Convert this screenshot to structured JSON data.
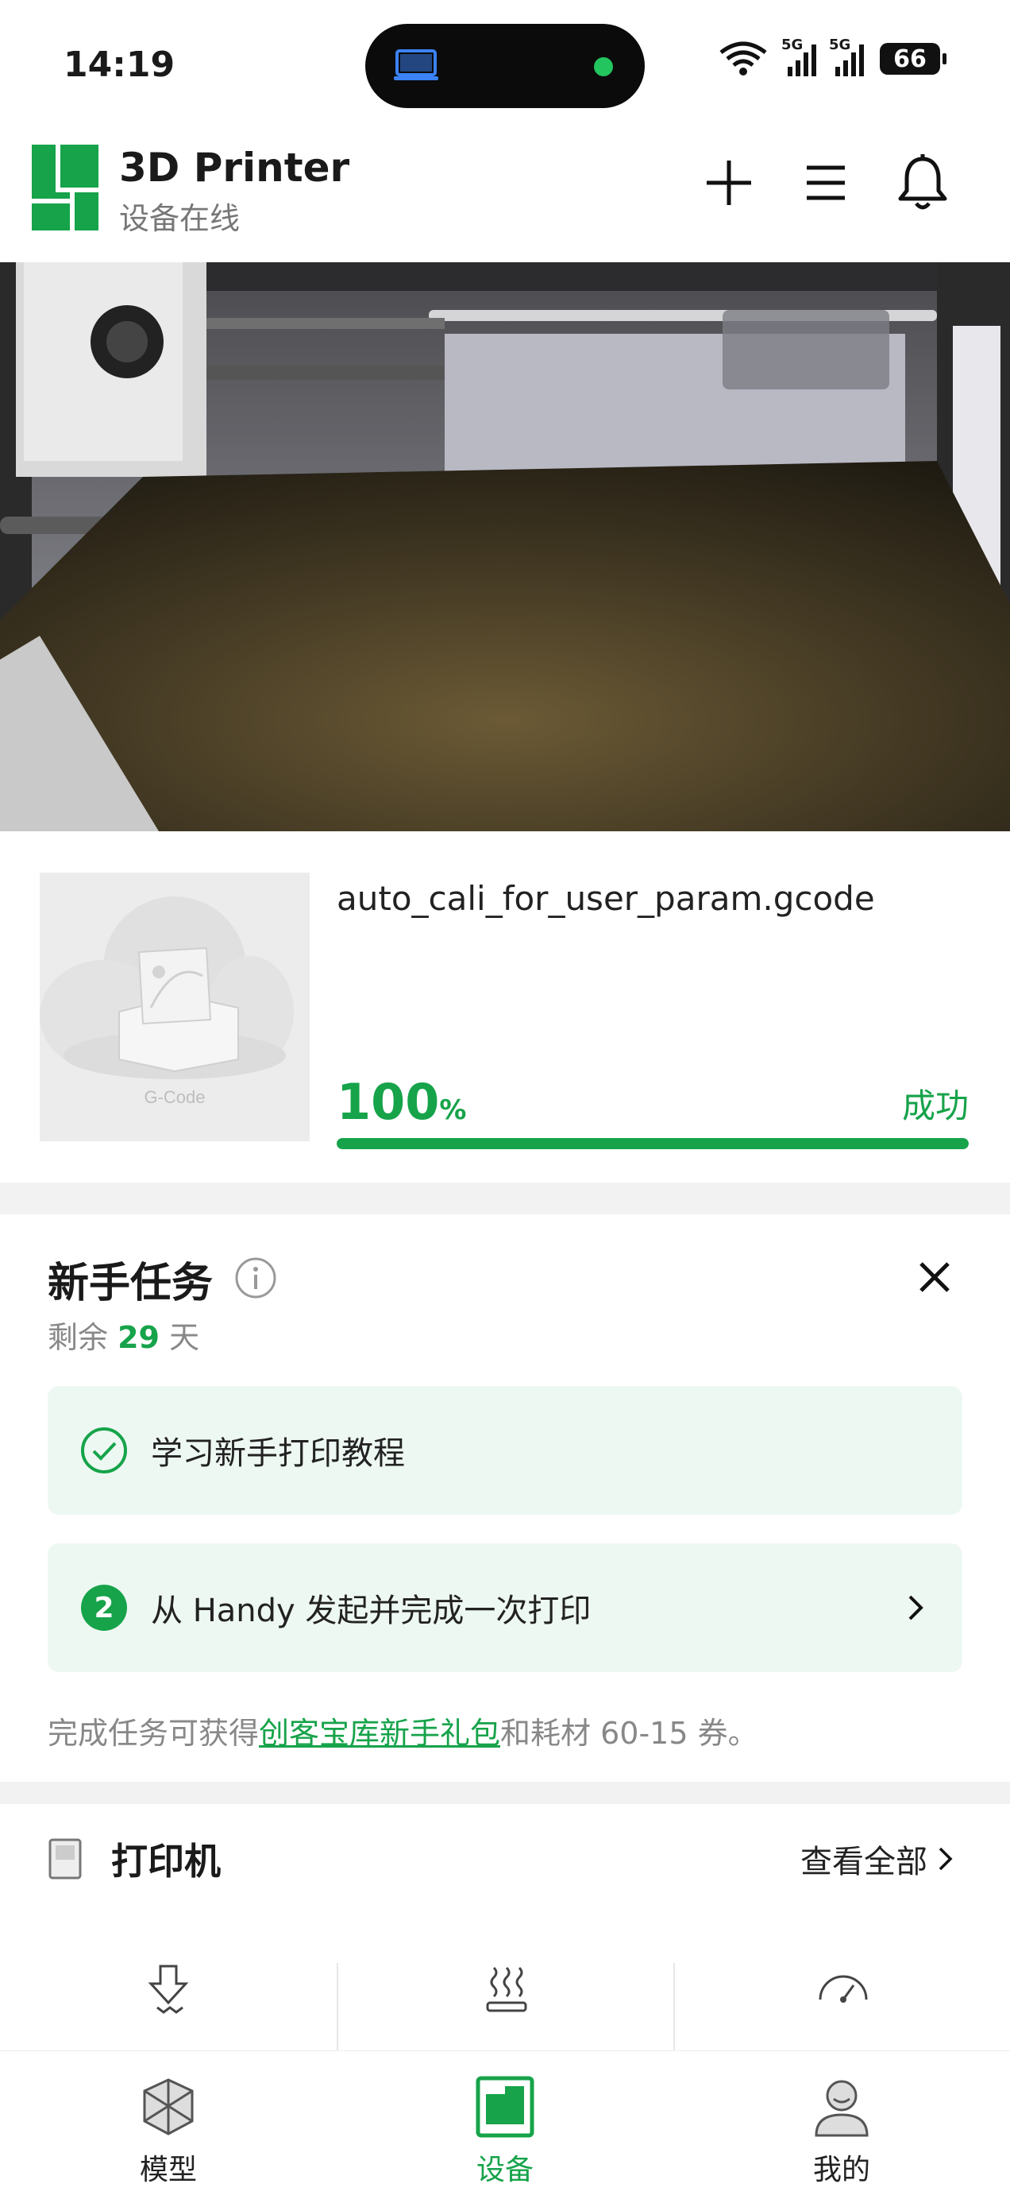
{
  "status_bar": {
    "time": "14:19",
    "signal_1": "5G",
    "signal_2": "5G",
    "battery": "66"
  },
  "header": {
    "title": "3D Printer",
    "subtitle": "设备在线"
  },
  "job": {
    "file_name": "auto_cali_for_user_param.gcode",
    "progress_value": "100",
    "progress_unit": "%",
    "progress_fraction": 1.0,
    "status": "成功",
    "thumbnail_caption": "G-Code"
  },
  "tasks": {
    "title": "新手任务",
    "remaining_prefix": "剩余",
    "remaining_days": "29",
    "remaining_suffix": "天",
    "items": [
      {
        "label": "学习新手打印教程",
        "state": "done"
      },
      {
        "number": "2",
        "label": "从 Handy 发起并完成一次打印",
        "state": "pending"
      }
    ],
    "reward_prefix": "完成任务可获得",
    "reward_link": "创客宝库新手礼包",
    "reward_suffix": "和耗材 60-15 券。"
  },
  "printer": {
    "title": "打印机",
    "view_all": "查看全部"
  },
  "nav": {
    "models": "模型",
    "devices": "设备",
    "mine": "我的"
  },
  "colors": {
    "accent": "#16a34a",
    "task_bg": "#eef8f2"
  }
}
